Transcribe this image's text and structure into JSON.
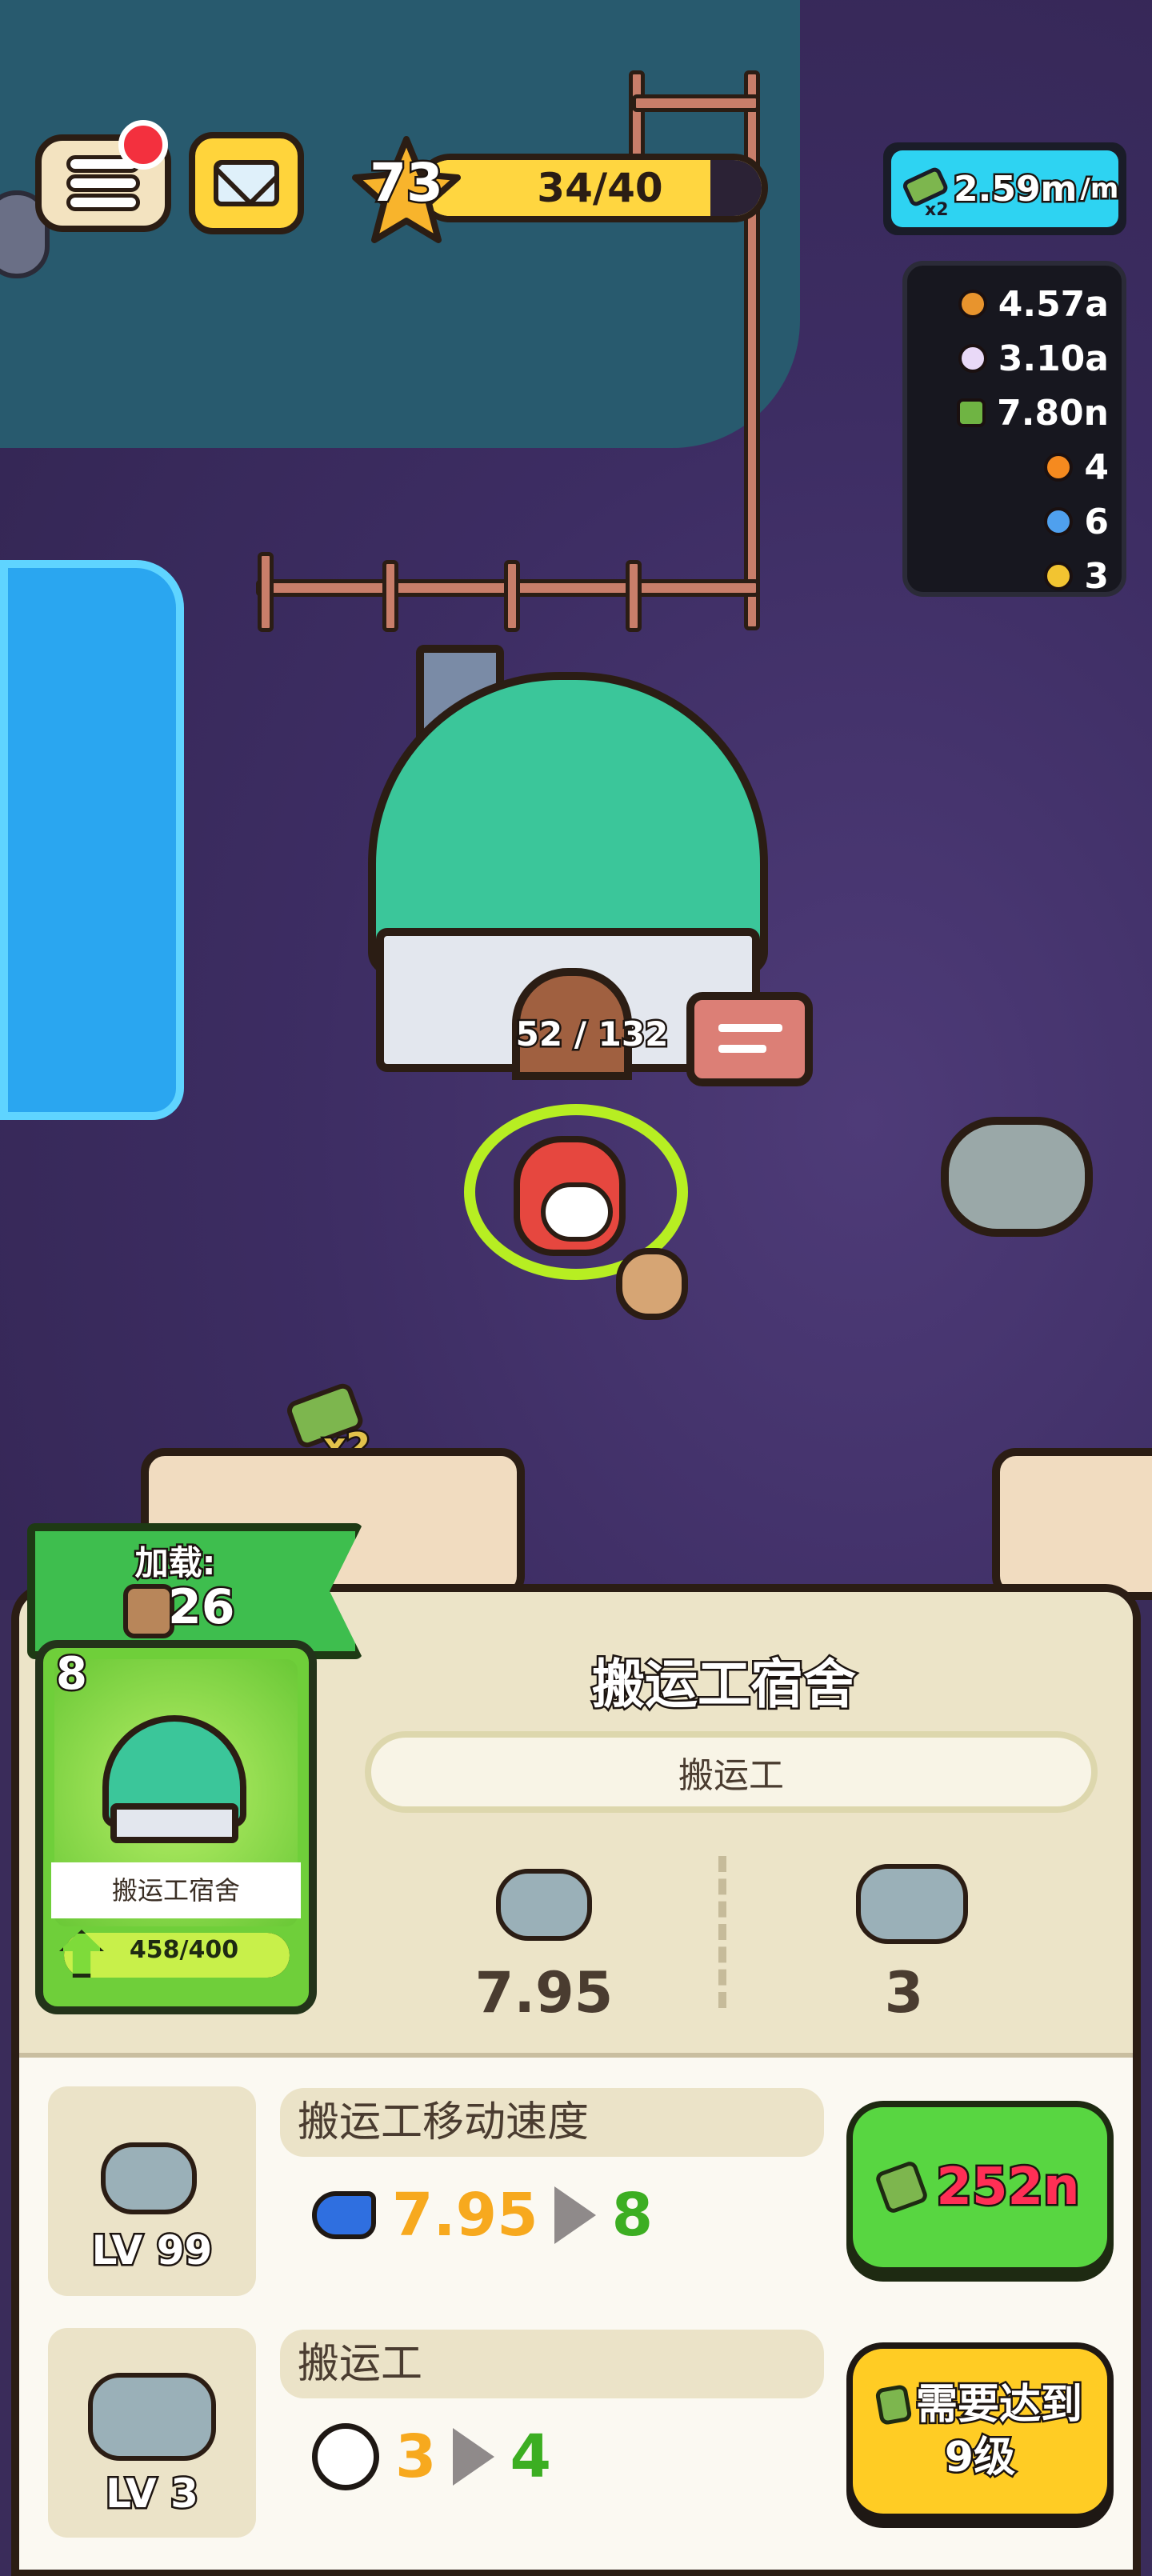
{
  "hud": {
    "level": "73",
    "xp_text": "34/40",
    "xp_progress": 0.85,
    "income_rate": "2.59m",
    "income_unit": "/m",
    "income_multiplier": "x2"
  },
  "resources": [
    {
      "icon": "cookie-icon",
      "value": "4.57a",
      "color": "#e8942d"
    },
    {
      "icon": "crystal-icon",
      "value": "3.10a",
      "color": "#e9d9f7"
    },
    {
      "icon": "cash-icon",
      "value": "7.80n",
      "color": "#6fb443"
    },
    {
      "icon": "orange-icon",
      "value": "4",
      "color": "#f58a1f"
    },
    {
      "icon": "potion-icon",
      "value": "6",
      "color": "#4fa0ee"
    },
    {
      "icon": "juice-icon",
      "value": "3",
      "color": "#f2c431"
    }
  ],
  "scene": {
    "capacity": "52 / 132",
    "cash_bonus": "x2"
  },
  "panel": {
    "load_label": "加载:",
    "load_value": "26",
    "card": {
      "level": "8",
      "name": "搬运工宿舍",
      "progress_text": "458/400",
      "progress": 1.0
    },
    "title": "搬运工宿舍",
    "subtitle": "搬运工",
    "stats": [
      {
        "icon": "worker-speed-icon",
        "value": "7.95"
      },
      {
        "icon": "worker-group-icon",
        "value": "3"
      }
    ],
    "upgrades": [
      {
        "level": "LV 99",
        "label": "搬运工移动速度",
        "icon": "sneaker-icon",
        "current": "7.95",
        "next": "8",
        "button": {
          "type": "buy",
          "price": "252n"
        }
      },
      {
        "level": "LV 3",
        "label": "搬运工",
        "icon": "worker-face-icon",
        "current": "3",
        "next": "4",
        "button": {
          "type": "locked",
          "line1": "需要达到",
          "line2": "9级"
        }
      }
    ]
  }
}
